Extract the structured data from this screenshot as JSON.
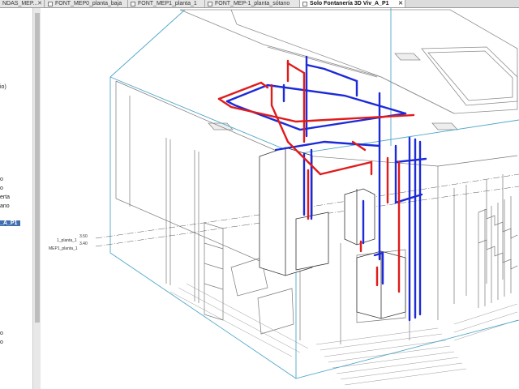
{
  "tabs": [
    {
      "label": "NDAS_MEP...",
      "close": "✕"
    },
    {
      "label": "FONT_MEP0_planta_baja"
    },
    {
      "label": "FONT_MEP1_planta_1"
    },
    {
      "label": "FONT_MEP-1_planta_sótano"
    },
    {
      "label": "Solo Fontanería 3D Viv_A_P1",
      "close": "✕"
    }
  ],
  "browser_items": [
    "io)",
    "o",
    "o",
    "erta",
    "ano",
    "_A_P1",
    "o",
    "o"
  ],
  "levels": {
    "upper": {
      "name": "1_planta_1",
      "value": "3.50"
    },
    "lower": {
      "name": "MEP1_planta_1",
      "value": "3.40"
    }
  },
  "colors": {
    "cold_water": "#1c2ad8",
    "hot_water": "#e01b1b",
    "section_box": "#4fa7c9",
    "selected": "#3f6fb0"
  }
}
